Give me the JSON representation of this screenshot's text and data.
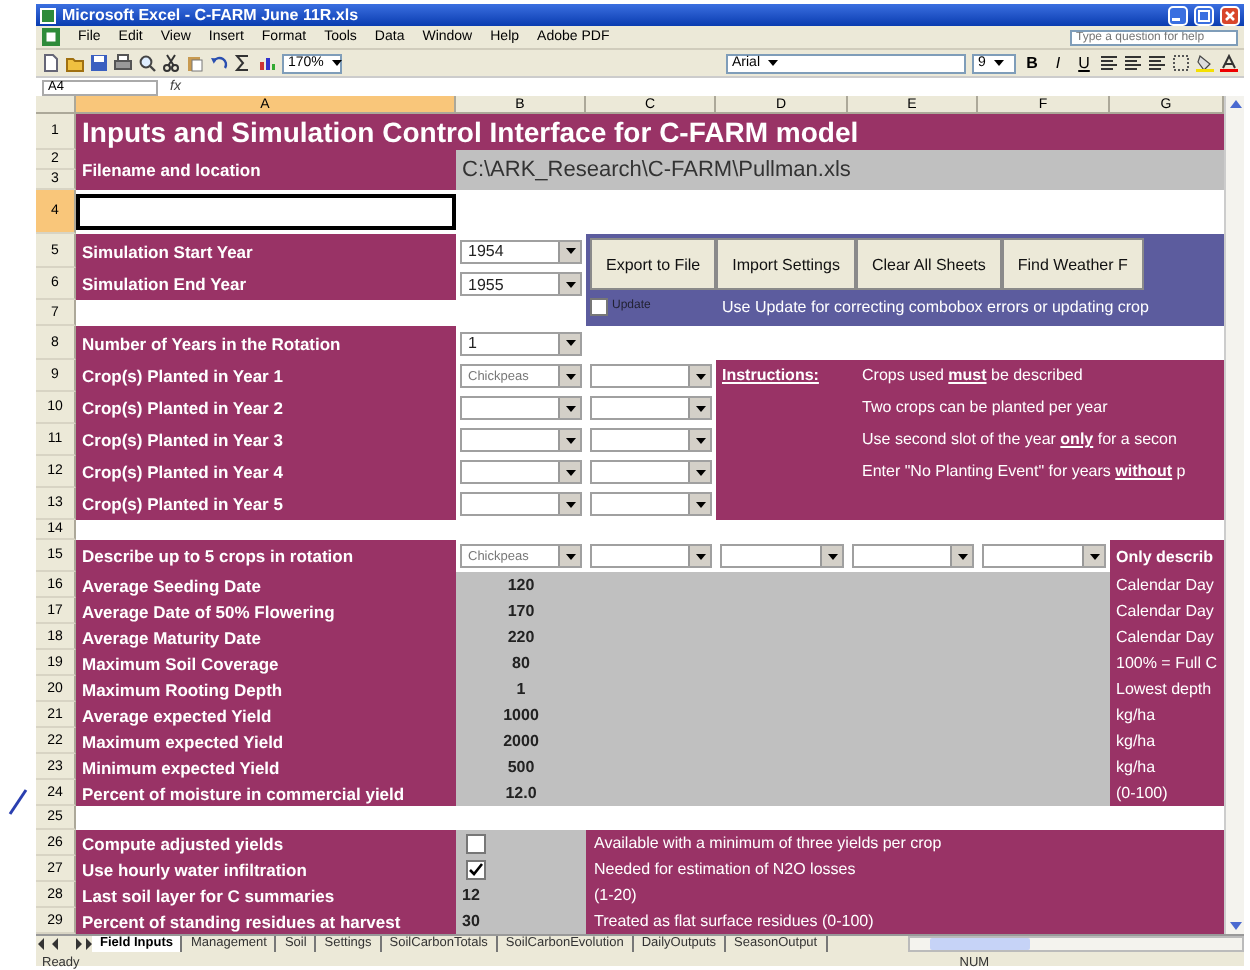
{
  "window": {
    "title": "Microsoft Excel - C-FARM June 11R.xls"
  },
  "menu": [
    "File",
    "Edit",
    "View",
    "Insert",
    "Format",
    "Tools",
    "Data",
    "Window",
    "Help",
    "Adobe PDF"
  ],
  "help_box": {
    "placeholder": "Type a question for help"
  },
  "toolbar": {
    "zoom": "170%",
    "font": "Arial",
    "font_size": "9",
    "format_buttons": [
      "B",
      "I",
      "U"
    ]
  },
  "formula_bar": {
    "name_box": "A4",
    "function_label": "fx"
  },
  "columns": [
    {
      "label": "A",
      "selected": true
    },
    {
      "label": "B",
      "selected": false
    },
    {
      "label": "C",
      "selected": false
    },
    {
      "label": "D",
      "selected": false
    },
    {
      "label": "E",
      "selected": false
    },
    {
      "label": "F",
      "selected": false
    },
    {
      "label": "G",
      "selected": false
    }
  ],
  "row_headers": [
    {
      "label": "1",
      "selected": false
    },
    {
      "label": "2",
      "selected": false
    },
    {
      "label": "3",
      "selected": false
    },
    {
      "label": "4",
      "selected": true
    },
    {
      "label": "5",
      "selected": false
    },
    {
      "label": "6",
      "selected": false
    },
    {
      "label": "7",
      "selected": false
    },
    {
      "label": "8",
      "selected": false
    },
    {
      "label": "9",
      "selected": false
    },
    {
      "label": "10",
      "selected": false
    },
    {
      "label": "11",
      "selected": false
    },
    {
      "label": "12",
      "selected": false
    },
    {
      "label": "13",
      "selected": false
    },
    {
      "label": "14",
      "selected": false
    },
    {
      "label": "15",
      "selected": false
    },
    {
      "label": "16",
      "selected": false
    },
    {
      "label": "17",
      "selected": false
    },
    {
      "label": "18",
      "selected": false
    },
    {
      "label": "19",
      "selected": false
    },
    {
      "label": "20",
      "selected": false
    },
    {
      "label": "21",
      "selected": false
    },
    {
      "label": "22",
      "selected": false
    },
    {
      "label": "23",
      "selected": false
    },
    {
      "label": "24",
      "selected": false
    },
    {
      "label": "25",
      "selected": false
    },
    {
      "label": "26",
      "selected": false
    },
    {
      "label": "27",
      "selected": false
    },
    {
      "label": "28",
      "selected": false
    },
    {
      "label": "29",
      "selected": false
    }
  ],
  "sheet": {
    "title": "Inputs and Simulation Control Interface for C-FARM model",
    "filename": {
      "label": "Filename and location",
      "value": "C:\\ARK_Research\\C-FARM\\Pullman.xls"
    },
    "simulation": [
      {
        "label": "Simulation Start Year",
        "value": "1954"
      },
      {
        "label": "Simulation End Year",
        "value": "1955"
      }
    ],
    "control_panel": {
      "buttons": [
        "Export to File",
        "Import Settings",
        "Clear All Sheets",
        "Find Weather F"
      ],
      "update": {
        "label": "Update",
        "checked": false
      },
      "note": "Use Update for correcting combobox errors or updating crop"
    },
    "rotation_years": {
      "label": "Number of Years in the Rotation",
      "value": "1"
    },
    "plantings": [
      {
        "label": "Crop(s) Planted in Year 1",
        "crop": "Chickpeas"
      },
      {
        "label": "Crop(s) Planted in Year 2"
      },
      {
        "label": "Crop(s) Planted in Year 3"
      },
      {
        "label": "Crop(s) Planted in Year 4"
      },
      {
        "label": "Crop(s) Planted in Year 5"
      }
    ],
    "instructions": {
      "heading": "Instructions:",
      "lines": [
        "Crops used **must** be described",
        "Two crops can be planted per year",
        "Use second slot of the year **only** for a secon",
        "Enter \"No Planting Event\" for years **without** p"
      ]
    },
    "describe": {
      "label": "Describe up to 5 crops in rotation",
      "crop": "Chickpeas",
      "note": "Only describ"
    },
    "properties": [
      {
        "label": "Average Seeding Date",
        "value": "120",
        "unit": "Calendar Day"
      },
      {
        "label": "Average Date of 50% Flowering",
        "value": "170",
        "unit": "Calendar Day"
      },
      {
        "label": "Average Maturity Date",
        "value": "220",
        "unit": "Calendar Day"
      },
      {
        "label": "Maximum Soil Coverage",
        "value": "80",
        "unit": "100% = Full C"
      },
      {
        "label": "Maximum Rooting Depth",
        "value": "1",
        "unit": "Lowest depth"
      },
      {
        "label": "Average expected Yield",
        "value": "1000",
        "unit": "kg/ha"
      },
      {
        "label": "Maximum expected Yield",
        "value": "2000",
        "unit": "kg/ha"
      },
      {
        "label": "Minimum expected Yield",
        "value": "500",
        "unit": "kg/ha"
      },
      {
        "label": "Percent of moisture in commercial yield",
        "value": "12.0",
        "unit": "(0-100)"
      }
    ],
    "options": [
      {
        "label": "Compute adjusted yields",
        "kind": "checkbox",
        "checked": false,
        "note": "Available with a minimum of three yields per crop"
      },
      {
        "label": "Use hourly water infiltration",
        "kind": "checkbox",
        "checked": true,
        "note": "Needed for estimation of N2O losses"
      },
      {
        "label": "Last soil layer for C summaries",
        "kind": "number",
        "value": "12",
        "note": "(1-20)"
      },
      {
        "label": "Percent of standing residues at harvest",
        "kind": "number",
        "value": "30",
        "note": "Treated as flat surface residues (0-100)"
      }
    ]
  },
  "sheet_tabs": [
    {
      "label": "Field Inputs",
      "selected": true
    },
    {
      "label": "Management",
      "selected": false
    },
    {
      "label": "Soil",
      "selected": false
    },
    {
      "label": "Settings",
      "selected": false
    },
    {
      "label": "SoilCarbonTotals",
      "selected": false
    },
    {
      "label": "SoilCarbonEvolution",
      "selected": false
    },
    {
      "label": "DailyOutputs",
      "selected": false
    },
    {
      "label": "SeasonOutput",
      "selected": false
    }
  ],
  "status_bar": {
    "status": "Ready",
    "indicator": "NUM"
  }
}
